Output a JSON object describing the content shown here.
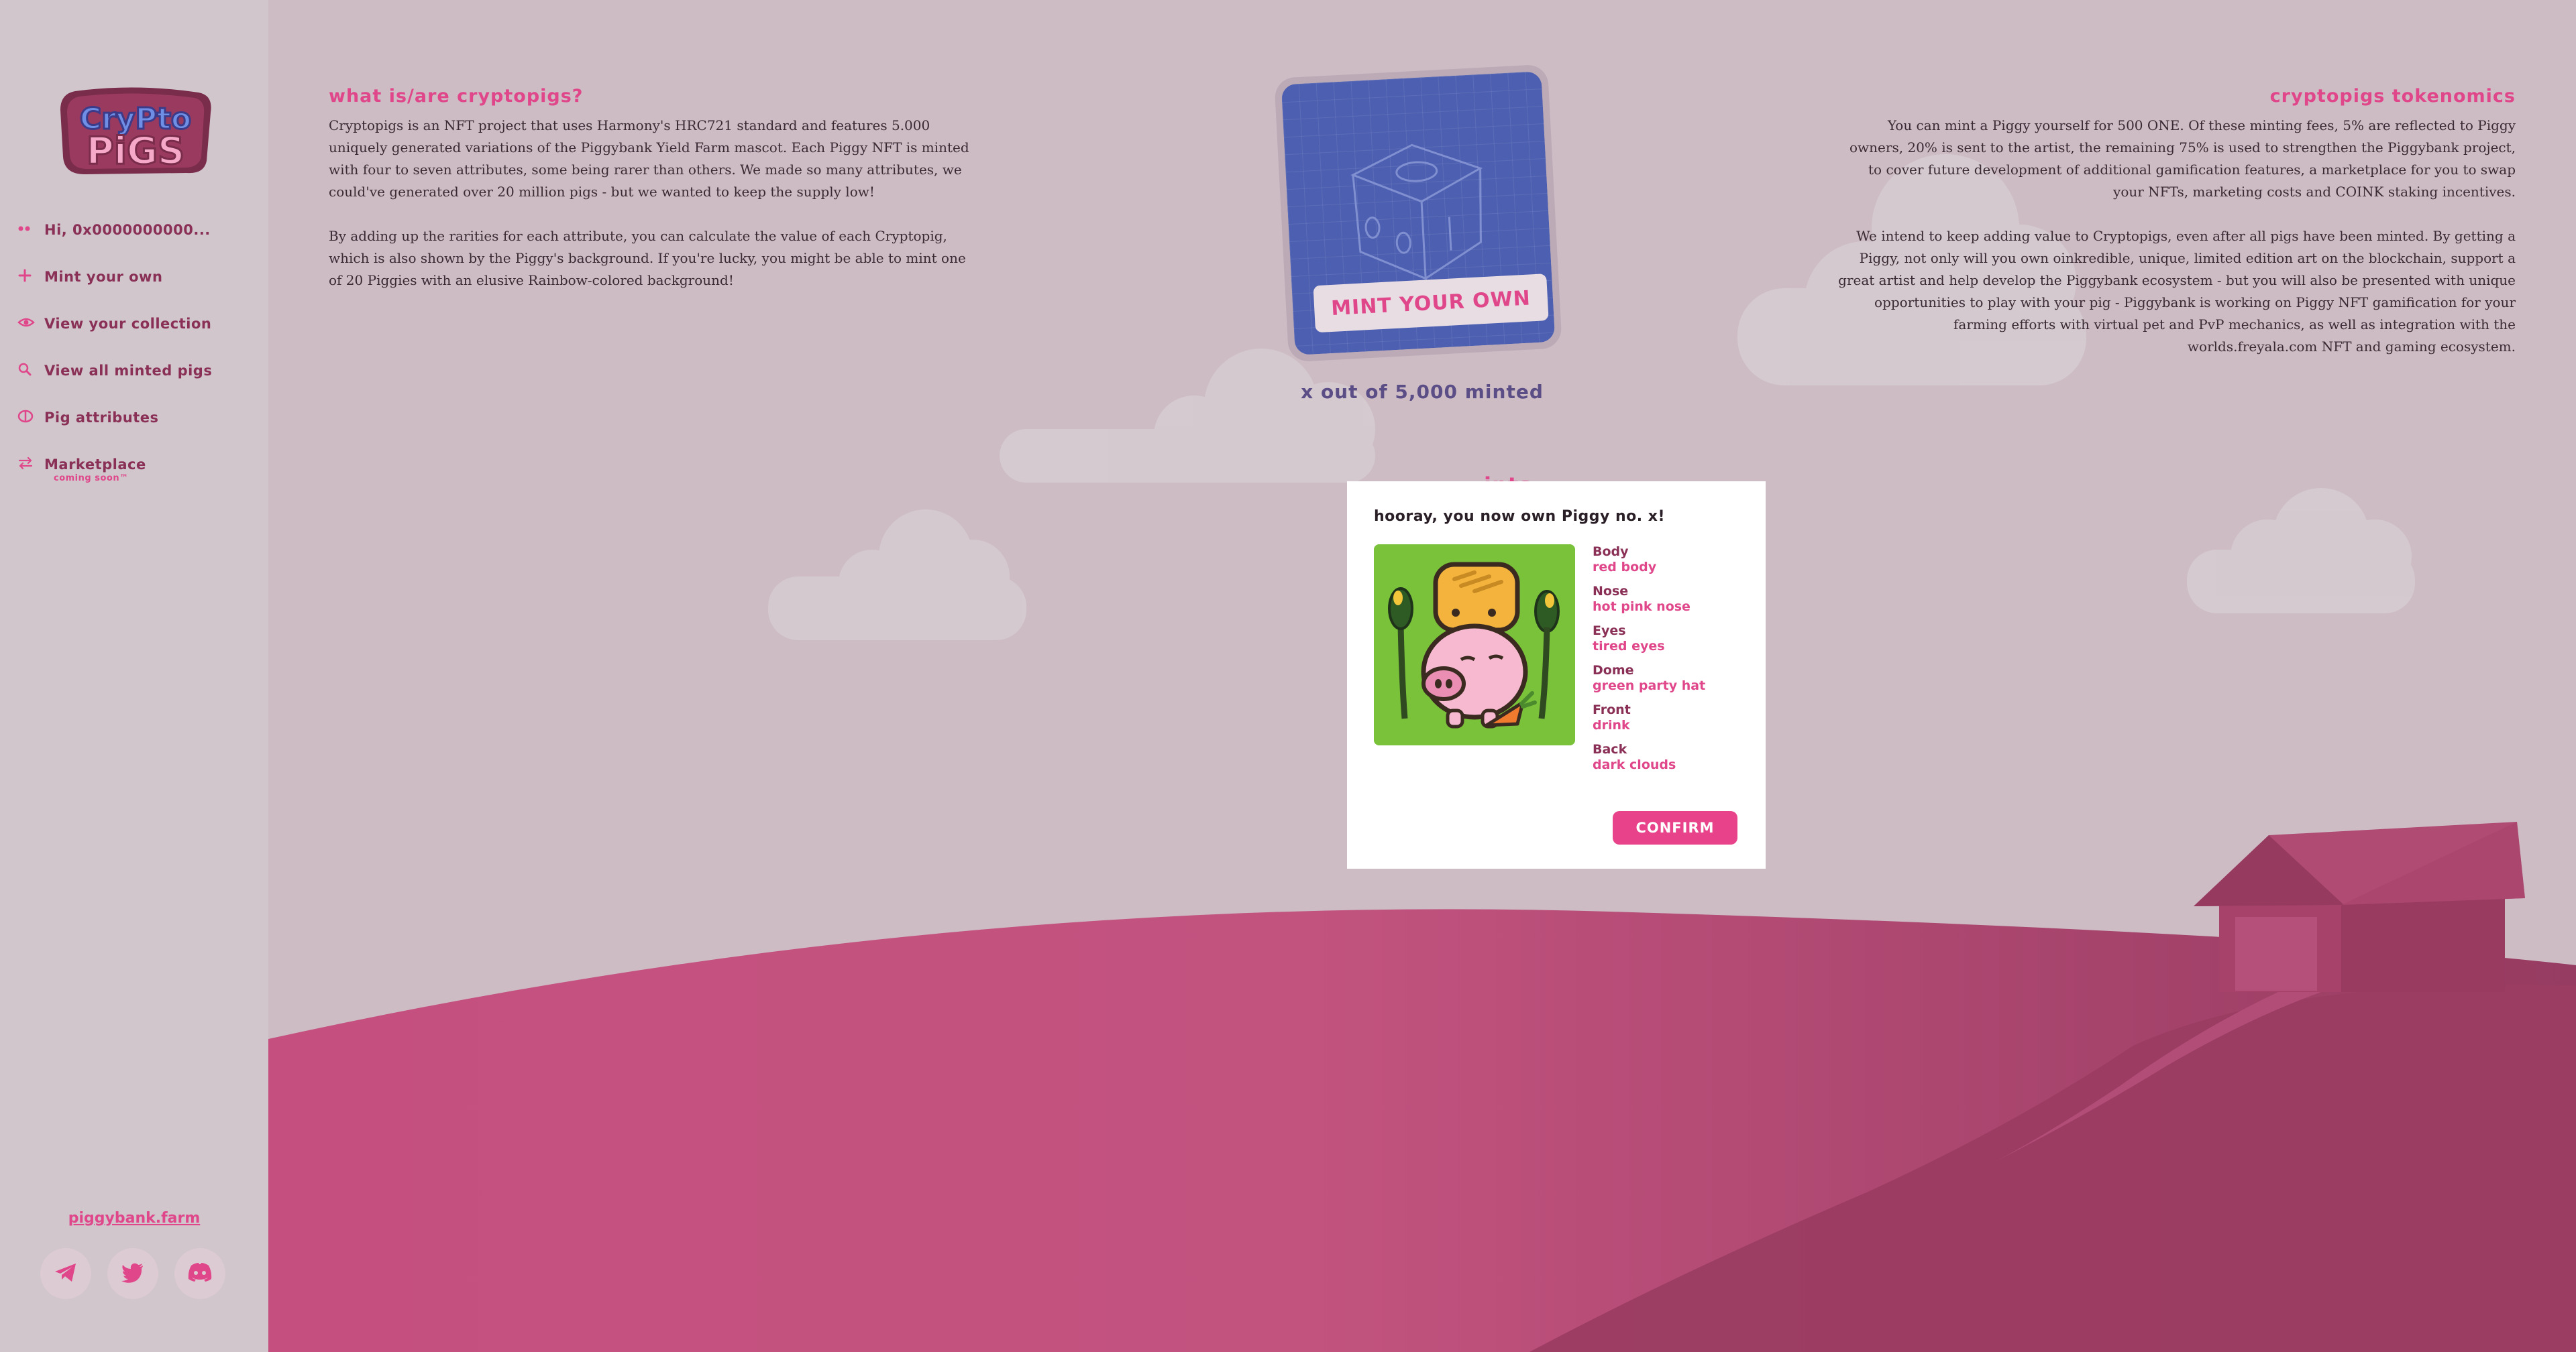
{
  "sidebar": {
    "logo_text": "CRYPTO PIGS",
    "items": [
      {
        "icon": "wallet-dots-icon",
        "label": "Hi, 0x0000000000..."
      },
      {
        "icon": "plus-icon",
        "label": "Mint your own"
      },
      {
        "icon": "eye-icon",
        "label": "View your collection"
      },
      {
        "icon": "search-icon",
        "label": "View all minted pigs"
      },
      {
        "icon": "attributes-icon",
        "label": "Pig attributes"
      },
      {
        "icon": "swap-arrows-icon",
        "label": "Marketplace",
        "sublabel": "coming soon™"
      }
    ],
    "site_link": "piggybank.farm",
    "socials": [
      "telegram-icon",
      "twitter-icon",
      "discord-icon"
    ]
  },
  "intro": {
    "title": "what is/are cryptopigs?",
    "paragraphs": [
      "Cryptopigs is an NFT project that uses Harmony's HRC721 standard and features 5.000 uniquely generated variations of the Piggybank Yield Farm mascot. Each Piggy NFT is minted with four to seven attributes, some being rarer than others. We made so many attributes, we could've generated over 20 million pigs - but we wanted to keep the supply low!",
      "By adding up the rarities for each attribute, you can calculate the value of each Cryptopig, which is also shown by the Piggy's background. If you're lucky, you might be able to mint one of 20 Piggies with an elusive Rainbow-colored background!"
    ]
  },
  "tokenomics": {
    "title": "cryptopigs tokenomics",
    "paragraphs": [
      "You can mint a Piggy yourself for 500 ONE. Of these minting fees, 5% are reflected to Piggy owners, 20% is sent to the artist, the remaining 75% is used to strengthen the Piggybank project, to cover future development of additional gamification features, a marketplace for you to swap your NFTs, marketing costs and COINK staking incentives.",
      "We intend to keep adding value to Cryptopigs, even after all pigs have been minted. By getting a Piggy, not only will you own oinkredible, unique, limited edition art on the blockchain, support a great artist and help develop the Piggybank ecosystem - but you will also be presented with unique opportunities to play with your pig - Piggybank is working on Piggy NFT gamification for your farming efforts with virtual pet and PvP mechanics, as well as integration with the worlds.freyala.com NFT and gaming ecosystem."
    ]
  },
  "mint": {
    "button_label": "MINT YOUR OWN",
    "minted_text": "x out of 5,000 minted",
    "recent_title_visible": "ints"
  },
  "modal": {
    "title": "hooray, you now own Piggy no. x!",
    "attributes": [
      {
        "key": "Body",
        "value": "red body"
      },
      {
        "key": "Nose",
        "value": "hot pink nose"
      },
      {
        "key": "Eyes",
        "value": "tired eyes"
      },
      {
        "key": "Dome",
        "value": "green party hat"
      },
      {
        "key": "Front",
        "value": "drink"
      },
      {
        "key": "Back",
        "value": "dark clouds"
      }
    ],
    "confirm_label": "CONFIRM"
  },
  "colors": {
    "accent": "#e0468a",
    "dark_accent": "#8a2f55",
    "background": "#cdbcc4",
    "sidebar": "#d0c6cc",
    "hill": "#c5507f",
    "nft_green": "#7ac23a"
  }
}
